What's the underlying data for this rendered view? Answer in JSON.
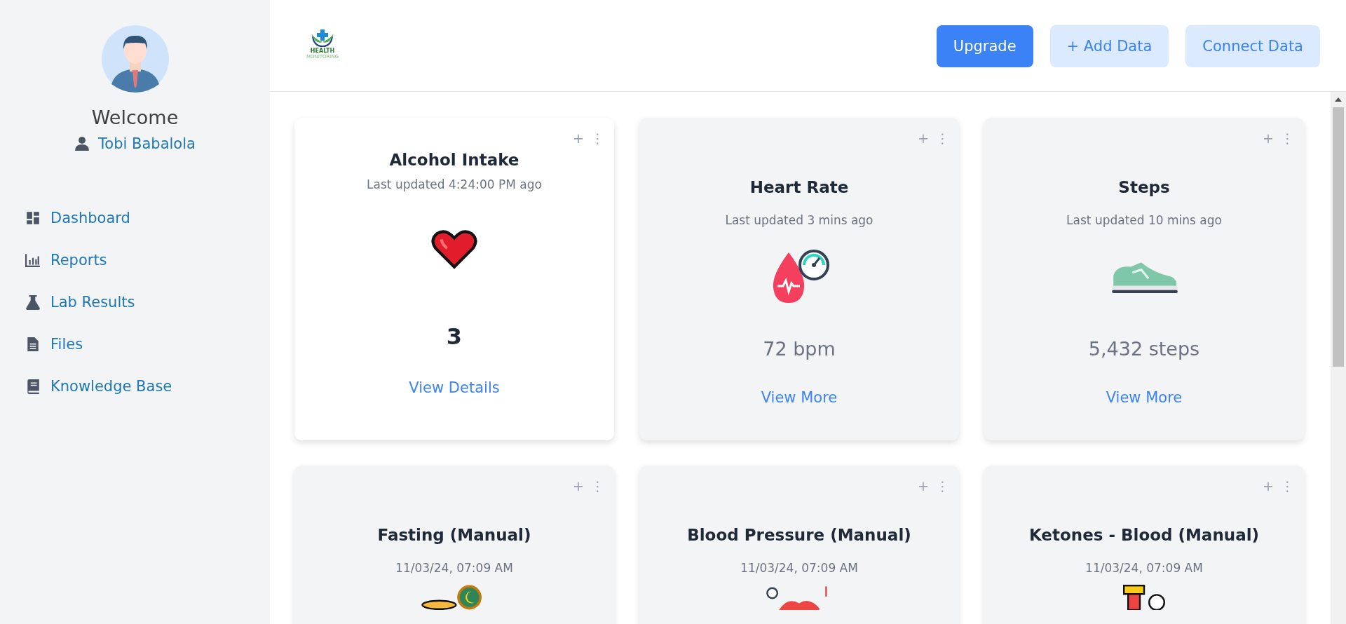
{
  "sidebar": {
    "welcome": "Welcome",
    "user_name": "Tobi Babalola",
    "items": [
      {
        "label": "Dashboard",
        "selected": false
      },
      {
        "label": "Reports",
        "selected": false
      },
      {
        "label": "Lab Results",
        "selected": false
      },
      {
        "label": "Files",
        "selected": false
      },
      {
        "label": "Knowledge Base",
        "selected": false
      }
    ]
  },
  "header": {
    "logo": {
      "line_1": "HEALTH",
      "line_2": "MONITORING"
    },
    "buttons": [
      {
        "label": "Upgrade",
        "kind": "primary"
      },
      {
        "label": "+ Add Data",
        "kind": "secondary"
      },
      {
        "label": "Connect Data",
        "kind": "secondary"
      }
    ]
  },
  "cards": [
    {
      "title": "Alcohol Intake",
      "updated": "Last updated 4:24:00 PM ago",
      "value": "3",
      "kind": "count",
      "link": "View Details",
      "highlighted": true,
      "add": "+",
      "menu": "⋮"
    },
    {
      "title": "Heart Rate",
      "updated": "Last updated 3 mins ago",
      "value": "72 bpm",
      "kind": "reading",
      "link": "View More",
      "highlighted": false,
      "add": "+",
      "menu": "⋮"
    },
    {
      "title": "Steps",
      "updated": "Last updated 10 mins ago",
      "value": "5,432 steps",
      "kind": "reading",
      "link": "View More",
      "highlighted": false,
      "add": "+",
      "menu": "⋮"
    },
    {
      "title": "Fasting (Manual)",
      "updated": "11/03/24, 07:09 AM",
      "highlighted": false,
      "add": "+",
      "menu": "⋮"
    },
    {
      "title": "Blood Pressure (Manual)",
      "updated": "11/03/24, 07:09 AM",
      "highlighted": false,
      "add": "+",
      "menu": "⋮"
    },
    {
      "title": "Ketones - Blood (Manual)",
      "updated": "11/03/24, 07:09 AM",
      "highlighted": false,
      "add": "+",
      "menu": "⋮"
    }
  ]
}
